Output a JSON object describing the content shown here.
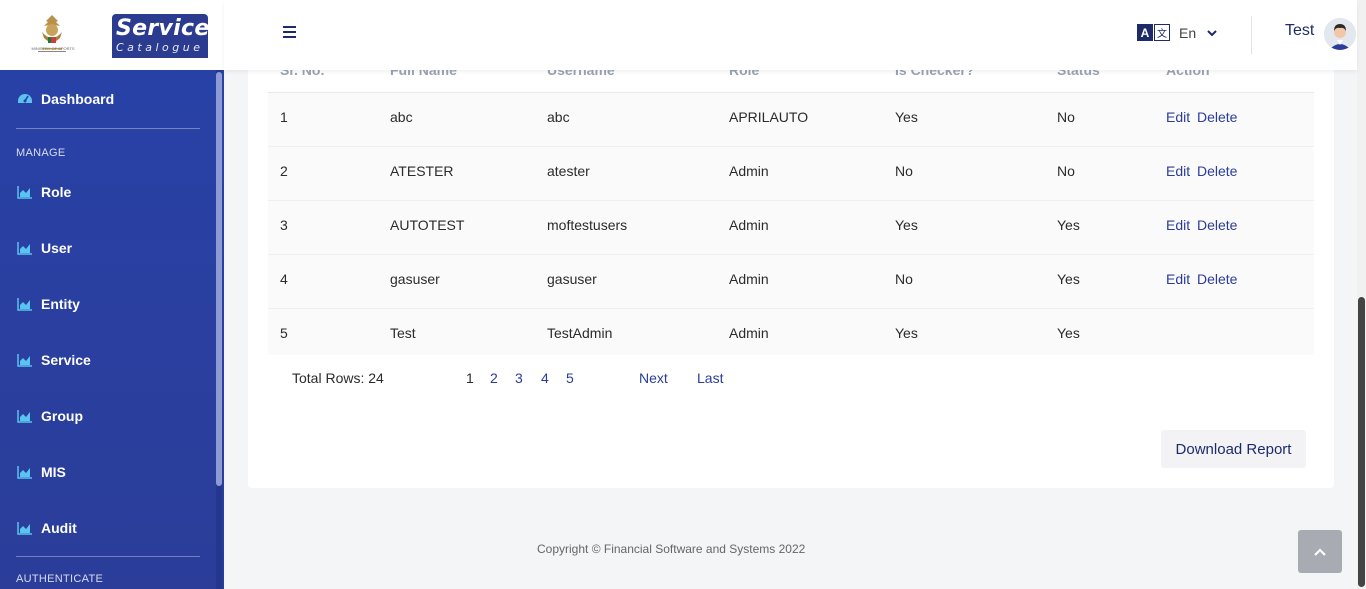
{
  "brand": {
    "title_top": "Service",
    "title_bottom": "Catalogue",
    "emblem_caption": "MINISTRY OF SPORTS"
  },
  "sidebar": {
    "dashboard": {
      "label": "Dashboard",
      "icon": "dashboard-icon"
    },
    "manage_header": "MANAGE",
    "items": [
      {
        "label": "Role",
        "icon": "chart-icon"
      },
      {
        "label": "User",
        "icon": "chart-icon"
      },
      {
        "label": "Entity",
        "icon": "chart-icon"
      },
      {
        "label": "Service",
        "icon": "chart-icon"
      },
      {
        "label": "Group",
        "icon": "chart-icon"
      },
      {
        "label": "MIS",
        "icon": "chart-icon"
      },
      {
        "label": "Audit",
        "icon": "chart-icon"
      }
    ],
    "authenticate_header": "AUTHENTICATE"
  },
  "topbar": {
    "language_icon_a": "A",
    "language_icon_b": "文",
    "language": "En",
    "user_name": "Test"
  },
  "table": {
    "headers": [
      "Sr. No.",
      "Full Name",
      "Username",
      "Role",
      "Is Checker?",
      "Status",
      "Action"
    ],
    "rows": [
      {
        "sr": "1",
        "full_name": "abc",
        "username": "abc",
        "role": "APRILAUTO",
        "checker": "Yes",
        "status": "No",
        "edit": "Edit",
        "delete": "Delete"
      },
      {
        "sr": "2",
        "full_name": "ATESTER",
        "username": "atester",
        "role": "Admin",
        "checker": "No",
        "status": "No",
        "edit": "Edit",
        "delete": "Delete"
      },
      {
        "sr": "3",
        "full_name": "AUTOTEST",
        "username": "moftestusers",
        "role": "Admin",
        "checker": "Yes",
        "status": "Yes",
        "edit": "Edit",
        "delete": "Delete"
      },
      {
        "sr": "4",
        "full_name": "gasuser",
        "username": "gasuser",
        "role": "Admin",
        "checker": "No",
        "status": "Yes",
        "edit": "Edit",
        "delete": "Delete"
      },
      {
        "sr": "5",
        "full_name": "Test",
        "username": "TestAdmin",
        "role": "Admin",
        "checker": "Yes",
        "status": "Yes",
        "edit": "",
        "delete": ""
      }
    ]
  },
  "pagination": {
    "total_label": "Total Rows: 24",
    "pages": [
      "1",
      "2",
      "3",
      "4",
      "5"
    ],
    "current_page": "1",
    "next": "Next",
    "last": "Last"
  },
  "download_label": "Download Report",
  "copyright": "Copyright © Financial Software and Systems 2022",
  "colors": {
    "sidebar": "#2a3f9f",
    "accent": "#2b3d99",
    "header_text": "#1d2b6b"
  }
}
